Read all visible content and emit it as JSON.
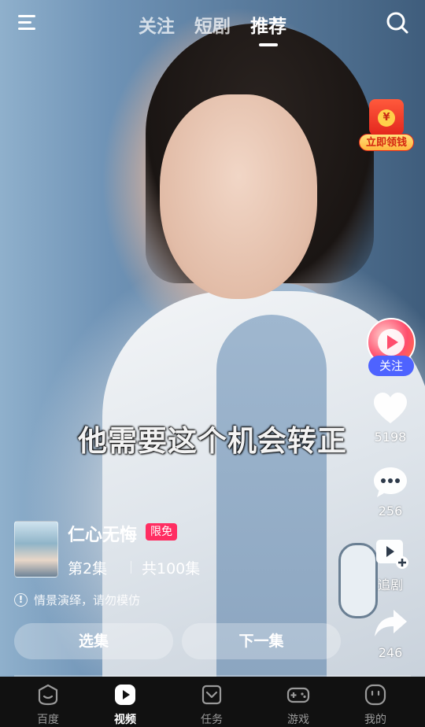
{
  "top_nav": {
    "tabs": [
      {
        "label": "关注",
        "active": false
      },
      {
        "label": "短剧",
        "active": false
      },
      {
        "label": "推荐",
        "active": true
      }
    ]
  },
  "promo": {
    "label": "立即领钱",
    "coin_symbol": "¥"
  },
  "video": {
    "subtitle": "他需要这个机会转正",
    "progress_fraction": 0.0
  },
  "right_rail": {
    "follow_label": "关注",
    "like_count": "5198",
    "comment_count": "256",
    "bookmark_label": "追剧",
    "share_count": "246"
  },
  "drama": {
    "title": "仁心无悔",
    "badge": "限免",
    "episode_current": "第2集",
    "episode_total": "共100集"
  },
  "notice": {
    "text": "情景演绎，请勿模仿"
  },
  "actions": {
    "select_label": "选集",
    "next_label": "下一集"
  },
  "bottom_nav": [
    {
      "label": "百度",
      "icon": "baidu-face-icon",
      "active": false
    },
    {
      "label": "视频",
      "icon": "play-icon",
      "active": true
    },
    {
      "label": "任务",
      "icon": "task-icon",
      "active": false
    },
    {
      "label": "游戏",
      "icon": "gamepad-icon",
      "active": false
    },
    {
      "label": "我的",
      "icon": "profile-icon",
      "active": false
    }
  ],
  "colors": {
    "follow_button": "#4e63ff",
    "free_badge": "#ff2e62",
    "bottom_bar": "#111111"
  }
}
